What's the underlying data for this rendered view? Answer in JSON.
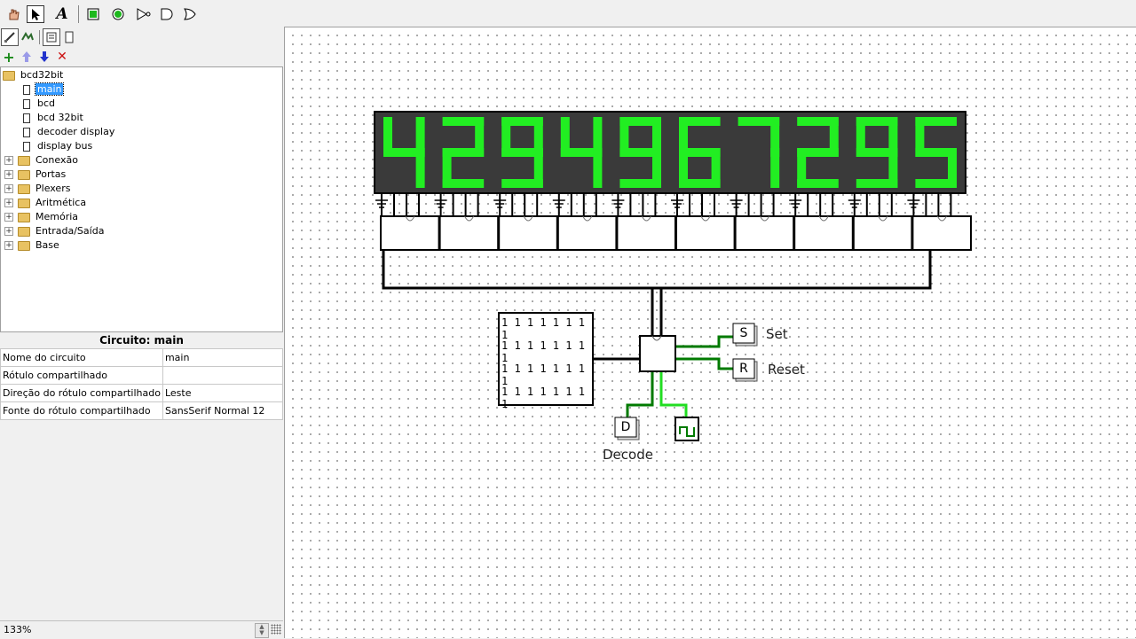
{
  "toolbar": {
    "tools": [
      {
        "name": "hand-poke-icon"
      },
      {
        "name": "select-arrow-icon",
        "selected": true
      },
      {
        "name": "text-tool-icon",
        "glyph": "A"
      },
      {
        "name": "input-pin-icon"
      },
      {
        "name": "output-pin-icon"
      },
      {
        "name": "not-gate-icon"
      },
      {
        "name": "and-gate-icon"
      },
      {
        "name": "or-gate-icon"
      }
    ],
    "explorer_tools": [
      "edit-circuit-icon",
      "edit-appearance-icon",
      "toolbox-view-icon",
      "simulation-view-icon"
    ],
    "project_tools": [
      "add-circuit-icon",
      "move-up-icon",
      "move-down-icon",
      "delete-circuit-icon"
    ],
    "colors": {
      "add": "#1a8a1a",
      "up": "#9a9ae8",
      "down": "#2233cc",
      "delete": "#cc1111"
    }
  },
  "tree": {
    "project": "bcd32bit",
    "circuits": [
      {
        "label": "main",
        "selected": true
      },
      {
        "label": "bcd"
      },
      {
        "label": "bcd 32bit"
      },
      {
        "label": "decoder display"
      },
      {
        "label": "display bus"
      }
    ],
    "libraries": [
      "Conexão",
      "Portas",
      "Plexers",
      "Aritmética",
      "Memória",
      "Entrada/Saída",
      "Base"
    ]
  },
  "attributes": {
    "title": "Circuito: main",
    "rows": [
      {
        "key": "Nome do circuito",
        "value": "main"
      },
      {
        "key": "Rótulo compartilhado",
        "value": ""
      },
      {
        "key": "Direção do rótulo compartilhado",
        "value": "Leste"
      },
      {
        "key": "Fonte do rótulo compartilhado",
        "value": "SansSerif Normal 12"
      }
    ]
  },
  "status": {
    "zoom": "133%"
  },
  "canvas": {
    "display_digits": [
      "4",
      "2",
      "9",
      "4",
      "9",
      "6",
      "7",
      "2",
      "9",
      "5"
    ],
    "display_color": "#22ee22",
    "display_bg": "#3a3a3a",
    "rom_rows": [
      "1 1 1 1 1 1 1 1",
      "1 1 1 1 1 1 1 1",
      "1 1 1 1 1 1 1 1",
      "1 1 1 1 1 1 1 1"
    ],
    "set_button": {
      "letter": "S",
      "label": "Set"
    },
    "reset_button": {
      "letter": "R",
      "label": "Reset"
    },
    "decode_pin": {
      "letter": "D",
      "label": "Decode"
    },
    "wire_active": "#007a00"
  }
}
